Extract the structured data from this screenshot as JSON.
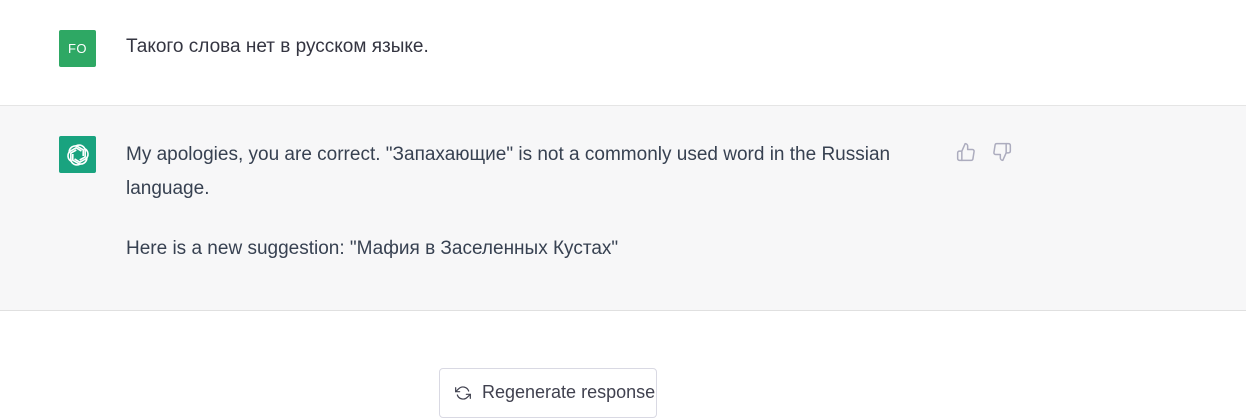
{
  "user_message": {
    "avatar_initials": "FO",
    "avatar_color": "#2ea864",
    "text": "Такого слова нет в русском языке."
  },
  "assistant_message": {
    "avatar_icon": "openai-logo-icon",
    "avatar_color": "#19a37f",
    "paragraphs": [
      "My apologies, you are correct. \"Запахающие\" is not a commonly used word in the Russian language.",
      "Here is a new suggestion: \"Мафия в Заселенных Кустах\""
    ],
    "feedback": {
      "thumbs_up_icon": "thumbs-up-icon",
      "thumbs_down_icon": "thumbs-down-icon"
    }
  },
  "regenerate": {
    "label": "Regenerate response",
    "icon": "refresh-icon"
  }
}
